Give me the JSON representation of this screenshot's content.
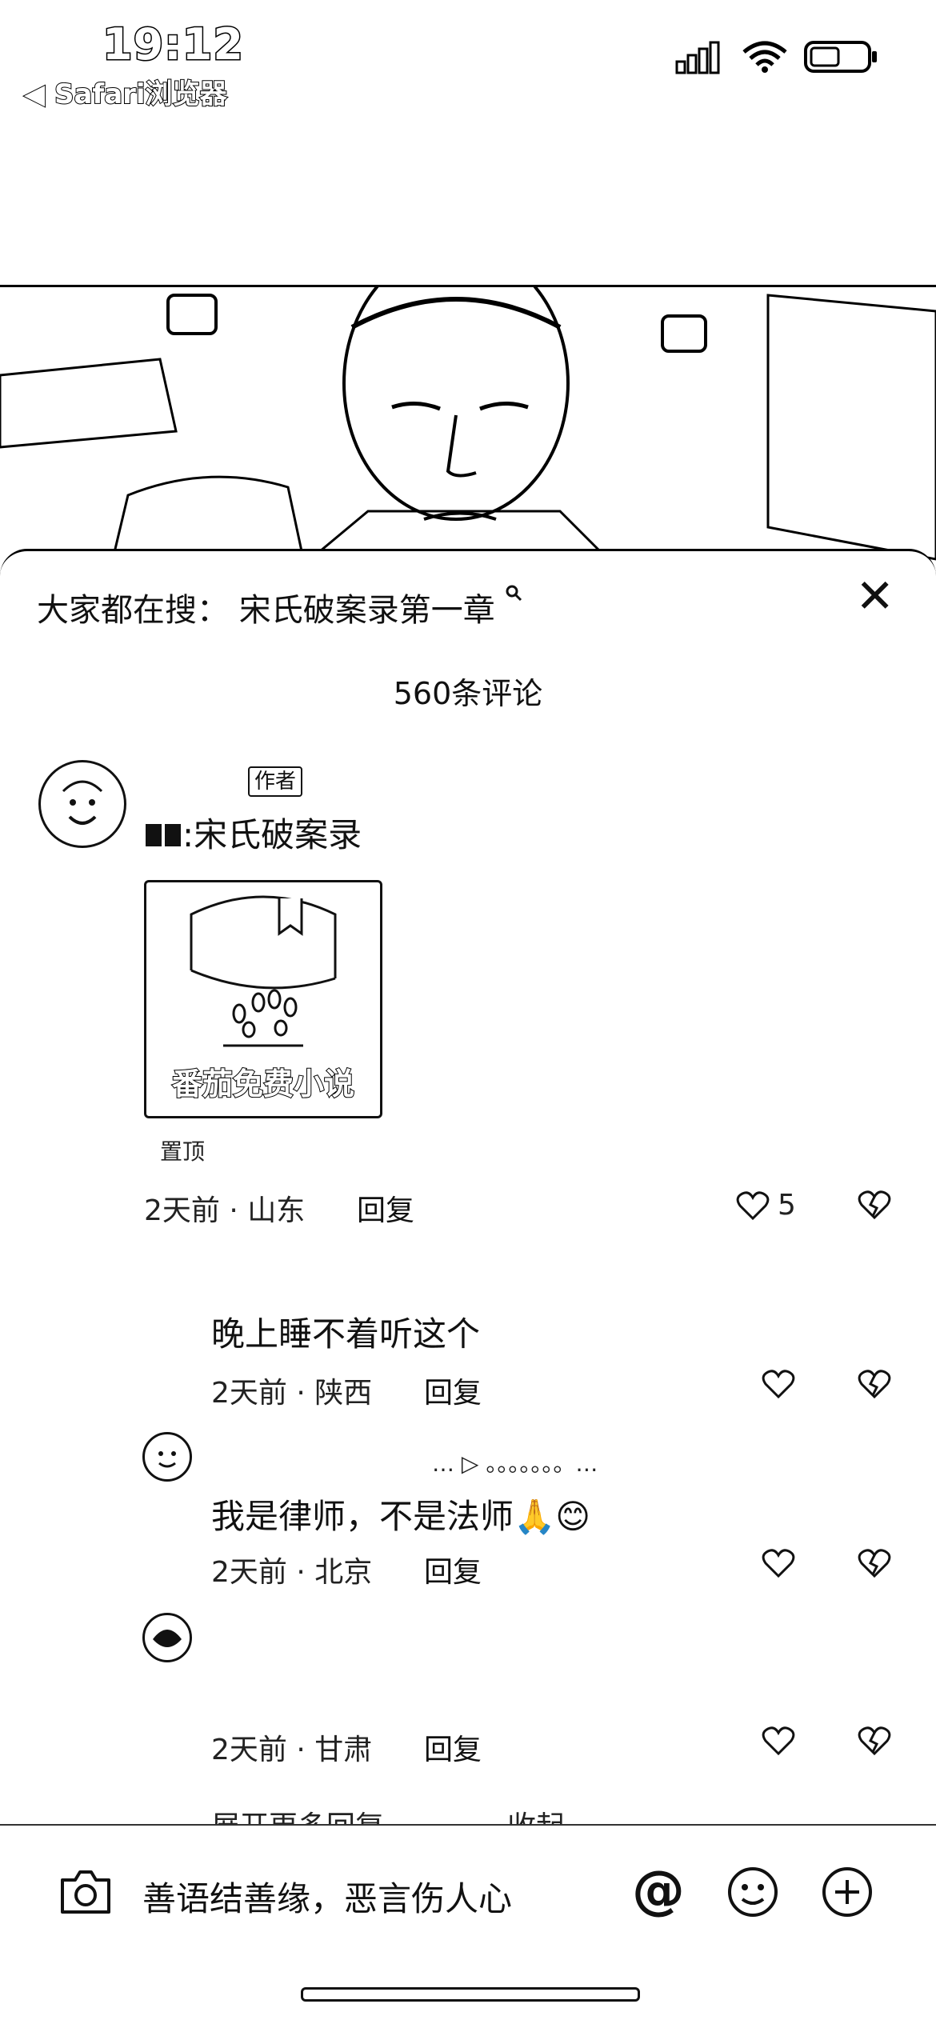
{
  "status_bar": {
    "time": "19:12",
    "back_label": "◀ Safari浏览器",
    "signal_icon": "signal-icon",
    "wifi_icon": "wifi-icon",
    "battery_icon": "battery-icon"
  },
  "sheet": {
    "search_prefix": "大家都在搜：",
    "search_term": "宋氏破案录第一章",
    "comment_count": "560条评论"
  },
  "comments": [
    {
      "tag": "作者",
      "text": ":宋氏破案录",
      "card_title": "番茄免费小说",
      "pinned": "置顶",
      "meta": "2天前 · 山东",
      "reply": "回复",
      "likes": "5"
    }
  ],
  "replies": [
    {
      "text": "晚上睡不着听这个",
      "meta": "2天前 · 陕西",
      "reply": "回复"
    },
    {
      "name": "… ▷ 。。。。。。。…",
      "text": "我是律师，不是法师🙏😊",
      "meta": "2天前 · 北京",
      "reply": "回复"
    },
    {
      "text": "",
      "meta": "2天前 · 甘肃",
      "reply": "回复"
    }
  ],
  "expand": {
    "more": "展开更多回复",
    "collapse": "收起"
  },
  "input": {
    "placeholder": "善语结善缘，恶言伤人心"
  },
  "colors": {
    "text": "#111111",
    "background": "#ffffff"
  }
}
